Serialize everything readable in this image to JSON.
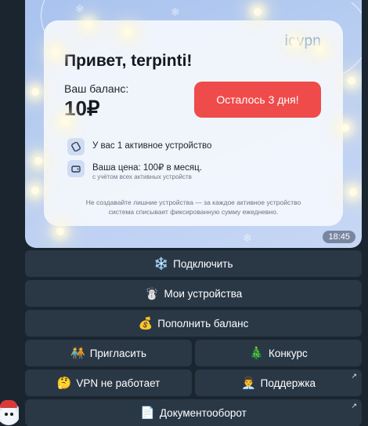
{
  "card": {
    "brand": "iovpn",
    "greeting": "Привет, terpinti!",
    "balance_label": "Ваш баланс:",
    "balance_value": "10₽",
    "days_left": "Осталось 3 дня!",
    "devices_text": "У вас 1 активное устройство",
    "price_text": "Ваша цена: 100₽ в месяц.",
    "price_sub": "с учётом всех активных устройств",
    "notice_line1": "Не создавайте лишние устройства — за каждое активное устройство",
    "notice_line2": "система списывает фиксированную сумму ежедневно.",
    "time": "18:45"
  },
  "keyboard": {
    "connect": {
      "emoji": "❄️",
      "label": "Подключить"
    },
    "devices": {
      "emoji": "☃️",
      "label": "Мои устройства"
    },
    "topup": {
      "emoji": "💰",
      "label": "Пополнить баланс"
    },
    "invite": {
      "emoji": "🧑‍🤝‍🧑",
      "label": "Пригласить"
    },
    "contest": {
      "emoji": "🎄",
      "label": "Конкурс"
    },
    "vpn_broken": {
      "emoji": "🤔",
      "label": "VPN не работает"
    },
    "support": {
      "emoji": "👨‍💼",
      "label": "Поддержка"
    },
    "docs": {
      "emoji": "📄",
      "label": "Документооборот"
    },
    "external_arrow": "↗"
  },
  "colors": {
    "background": "#1a2530",
    "button": "#2a3846",
    "accent_red": "#ef4b4b",
    "brand_blue": "#5d8fd8"
  }
}
